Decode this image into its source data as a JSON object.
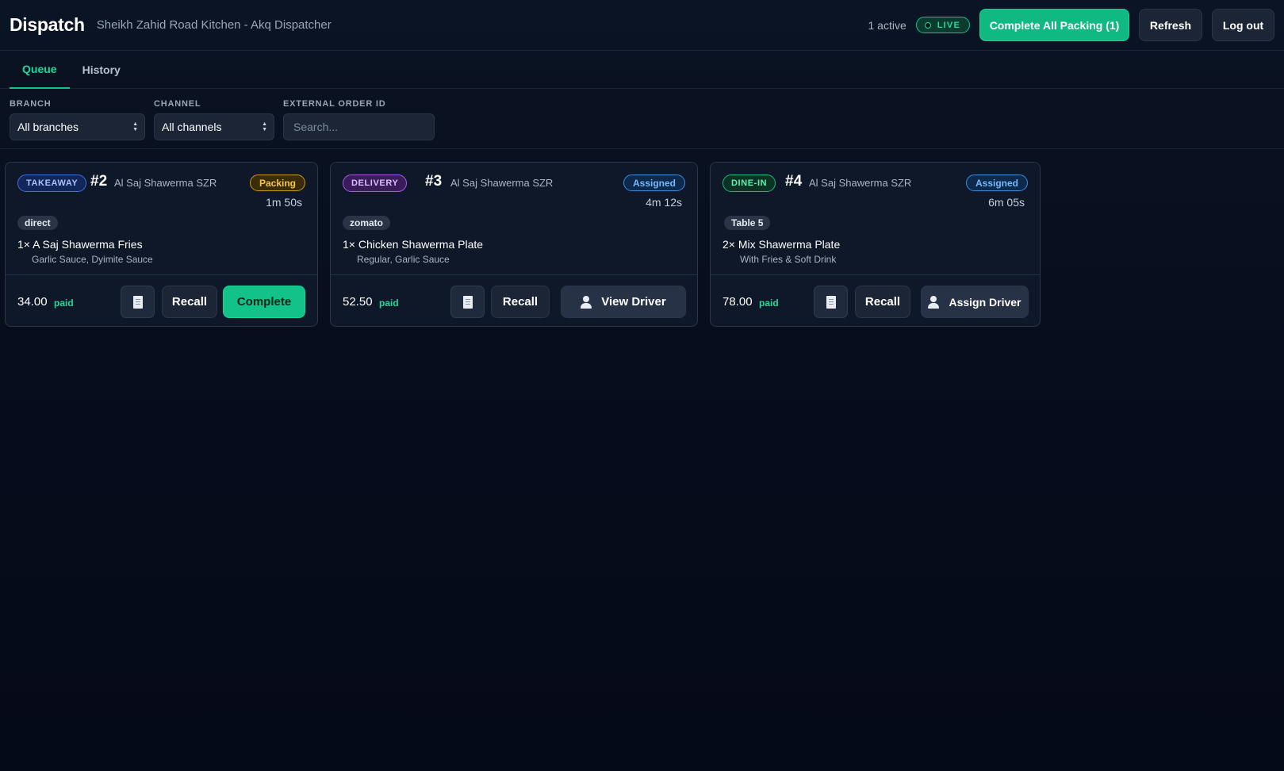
{
  "header": {
    "title": "Dispatch",
    "subtitle": "Sheikh Zahid Road Kitchen - Akq Dispatcher",
    "active_count": "1 active",
    "live_label": "LIVE",
    "complete_all_label": "Complete All Packing (1)",
    "refresh_label": "Refresh",
    "logout_label": "Log out"
  },
  "tabs": [
    {
      "label": "Queue",
      "active": true
    },
    {
      "label": "History",
      "active": false
    }
  ],
  "filters": {
    "branch": {
      "label": "BRANCH",
      "value": "All branches"
    },
    "channel": {
      "label": "CHANNEL",
      "value": "All channels"
    },
    "external_order_id": {
      "label": "EXTERNAL ORDER ID",
      "placeholder": "Search..."
    }
  },
  "colors": {
    "accent": "#10b981",
    "background": "#070d1c",
    "card": "#0e1829",
    "packing": "#f5c542",
    "assigned": "#74b8ff"
  },
  "orders": [
    {
      "type": "TAKEAWAY",
      "number": "#2",
      "branch": "Al Saj Shawerma SZR",
      "status": "Packing",
      "timer": "1m 50s",
      "channel": "direct",
      "item": "1× A Saj Shawerma Fries",
      "modifiers": "Garlic Sauce, Dyimite Sauce",
      "price": "34.00",
      "payment": "paid",
      "recall_label": "Recall",
      "action_label": "Complete"
    },
    {
      "type": "DELIVERY",
      "number": "#3",
      "branch": "Al Saj Shawerma SZR",
      "status": "Assigned",
      "timer": "4m 12s",
      "channel": "zomato",
      "item": "1× Chicken Shawerma Plate",
      "modifiers": "Regular, Garlic Sauce",
      "price": "52.50",
      "payment": "paid",
      "recall_label": "Recall",
      "action_label": "View Driver",
      "action_icon": "driver-icon"
    },
    {
      "type": "DINE-IN",
      "number": "#4",
      "branch": "Al Saj Shawerma SZR",
      "status": "Assigned",
      "timer": "6m 05s",
      "channel": "Table 5",
      "item": "2× Mix Shawerma Plate",
      "modifiers": "With Fries & Soft Drink",
      "price": "78.00",
      "payment": "paid",
      "recall_label": "Recall",
      "action_label": "Assign Driver",
      "action_icon": "driver-icon"
    }
  ]
}
